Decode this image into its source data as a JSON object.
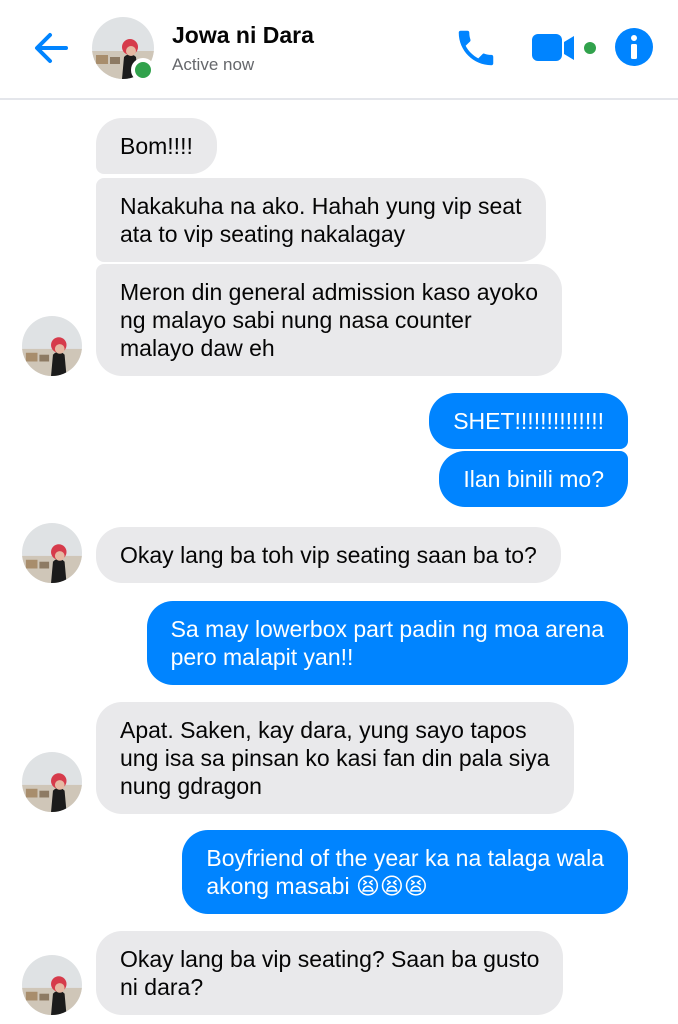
{
  "header": {
    "contact_name": "Jowa ni Dara",
    "status": "Active now"
  },
  "colors": {
    "accent": "#0084ff",
    "incoming_bubble": "#e9e9eb",
    "online": "#31a24c"
  },
  "icons": {
    "back": "arrow-left-icon",
    "call": "phone-icon",
    "video": "video-camera-icon",
    "info": "info-icon"
  },
  "messages": [
    {
      "id": 1,
      "direction": "incoming",
      "lines": [
        "Bom!!!!"
      ]
    },
    {
      "id": 2,
      "direction": "incoming",
      "lines": [
        "Nakakuha na ako. Hahah yung vip seat",
        "ata to vip seating nakalagay"
      ]
    },
    {
      "id": 3,
      "direction": "incoming",
      "lines": [
        "Meron din general admission kaso ayoko",
        "ng malayo sabi nung nasa counter",
        "malayo daw eh"
      ]
    },
    {
      "id": 4,
      "direction": "outgoing",
      "lines": [
        "SHET!!!!!!!!!!!!!!"
      ]
    },
    {
      "id": 5,
      "direction": "outgoing",
      "lines": [
        "Ilan binili mo?"
      ]
    },
    {
      "id": 6,
      "direction": "incoming",
      "lines": [
        "Okay lang ba toh vip seating saan ba to?"
      ]
    },
    {
      "id": 7,
      "direction": "outgoing",
      "lines": [
        "Sa may lowerbox part padin ng moa arena",
        "pero malapit yan!!"
      ]
    },
    {
      "id": 8,
      "direction": "incoming",
      "lines": [
        "Apat. Saken, kay dara, yung sayo tapos",
        "ung isa sa pinsan ko kasi fan din pala siya",
        "nung gdragon"
      ]
    },
    {
      "id": 9,
      "direction": "outgoing",
      "lines": [
        "Boyfriend of the year ka na talaga wala",
        "akong masabi 😫😫😫"
      ]
    },
    {
      "id": 10,
      "direction": "incoming",
      "lines": [
        "Okay lang ba vip seating? Saan ba gusto",
        "ni dara?"
      ]
    }
  ]
}
